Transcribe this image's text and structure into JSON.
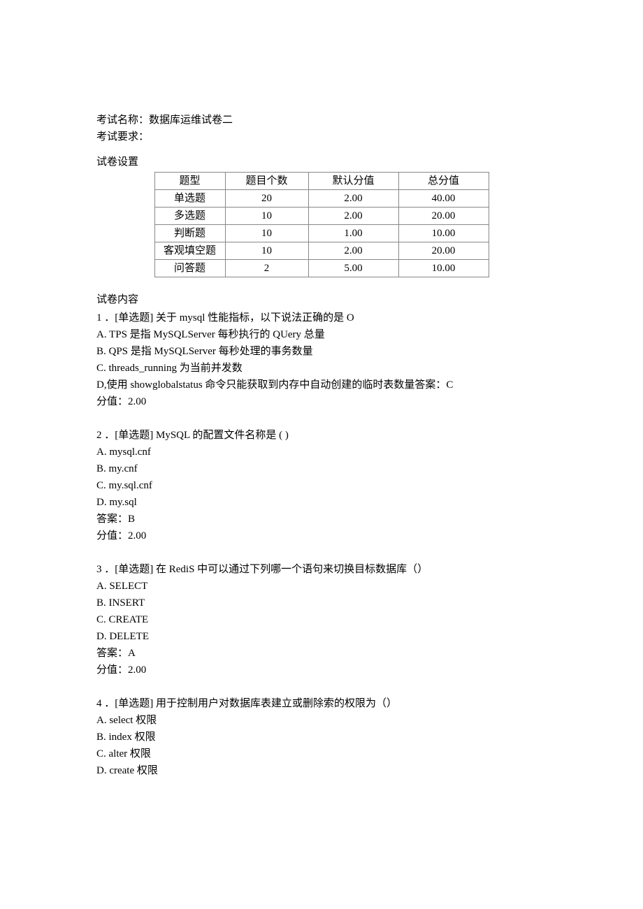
{
  "header": {
    "exam_name_label": "考试名称：",
    "exam_name_value": "数据库运维试卷二",
    "exam_req_label": "考试要求：",
    "settings_label": "试卷设置",
    "content_label": "试卷内容"
  },
  "table": {
    "headers": [
      "题型",
      "题目个数",
      "默认分值",
      "总分值"
    ],
    "rows": [
      [
        "单选题",
        "20",
        "2.00",
        "40.00"
      ],
      [
        "多选题",
        "10",
        "2.00",
        "20.00"
      ],
      [
        "判断题",
        "10",
        "1.00",
        "10.00"
      ],
      [
        "客观填空题",
        "10",
        "2.00",
        "20.00"
      ],
      [
        "问答题",
        "2",
        "5.00",
        "10.00"
      ]
    ]
  },
  "q1": {
    "stem": "1 ．[单选题] 关于 mysql 性能指标，以下说法正确的是 O",
    "a": "A.  TPS 是指 MySQLServer 每秒执行的 QUery 总量",
    "b": "B.  QPS 是指 MySQLServer 每秒处理的事务数量",
    "c": "C.  threads_running 为当前并发数",
    "d": "D,使用 showglobalstatus 命令只能获取到内存中自动创建的临时表数量答案：C",
    "score": "分值：2.00"
  },
  "q2": {
    "stem": "2 ．[单选题] MySQL 的配置文件名称是 (     )",
    "a": "A.  mysql.cnf",
    "b": "B.  my.cnf",
    "c": "C.  my.sql.cnf",
    "d": "D.  my.sql",
    "ans": "答案：B",
    "score": "分值：2.00"
  },
  "q3": {
    "stem": "3 ．[单选题] 在 RediS 中可以通过下列哪一个语句来切换目标数据库（）",
    "a": "A.  SELECT",
    "b": "B.  INSERT",
    "c": "C.  CREATE",
    "d": "D.  DELETE",
    "ans": "答案：A",
    "score": "分值：2.00"
  },
  "q4": {
    "stem": "4 ．[单选题] 用于控制用户对数据库表建立或删除索的权限为（）",
    "a": "A.  select 权限",
    "b": "B.  index 权限",
    "c": "C.  alter 权限",
    "d": "D.  create 权限"
  }
}
